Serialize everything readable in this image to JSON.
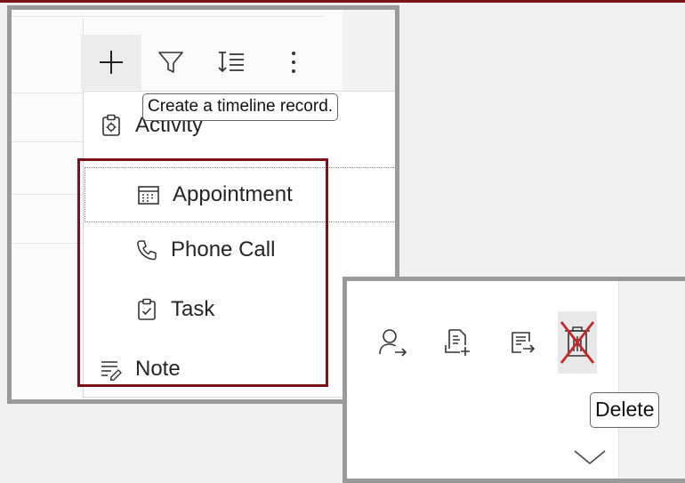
{
  "toolbar": {
    "icons": [
      "add-icon",
      "filter-icon",
      "sort-icon",
      "more-options-icon"
    ],
    "tooltip": "Create a timeline record."
  },
  "create_menu": {
    "items": [
      {
        "label": "Activity",
        "icon": "activity-icon"
      },
      {
        "label": "Appointment",
        "icon": "calendar-icon"
      },
      {
        "label": "Phone Call",
        "icon": "phone-icon"
      },
      {
        "label": "Task",
        "icon": "task-icon"
      },
      {
        "label": "Note",
        "icon": "note-icon"
      }
    ]
  },
  "record_actions": {
    "icons": [
      "assign-icon",
      "add-to-queue-icon",
      "open-record-icon",
      "delete-icon"
    ],
    "tooltip": "Delete",
    "expand_icon": "chevron-down-icon"
  },
  "colors": {
    "highlight": "#7a1418",
    "strike": "#c62828",
    "frame": "#9a9a9a"
  }
}
